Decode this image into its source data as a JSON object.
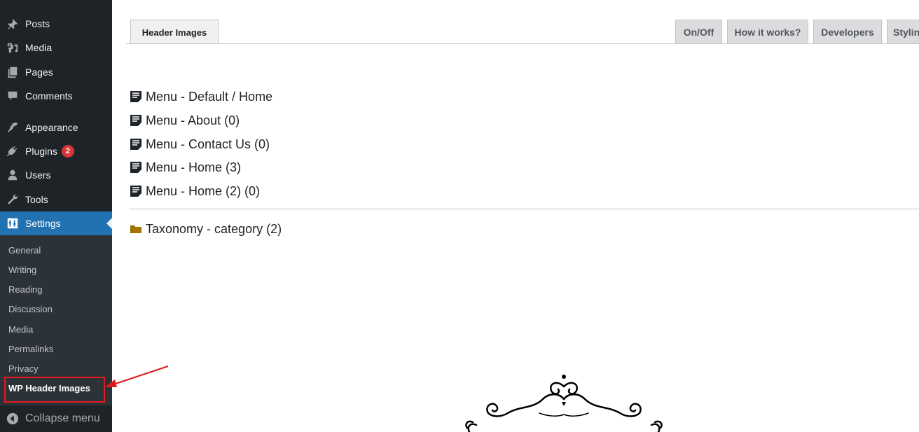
{
  "sidebar": {
    "items": [
      {
        "label": "Posts",
        "icon": "pin-icon"
      },
      {
        "label": "Media",
        "icon": "media-icon"
      },
      {
        "label": "Pages",
        "icon": "pages-icon"
      },
      {
        "label": "Comments",
        "icon": "comment-icon"
      },
      {
        "label": "Appearance",
        "icon": "paintbrush-icon"
      },
      {
        "label": "Plugins",
        "icon": "plugin-icon",
        "badge": "2"
      },
      {
        "label": "Users",
        "icon": "user-icon"
      },
      {
        "label": "Tools",
        "icon": "wrench-icon"
      },
      {
        "label": "Settings",
        "icon": "settings-icon",
        "active": true
      }
    ],
    "submenu": [
      {
        "label": "General"
      },
      {
        "label": "Writing"
      },
      {
        "label": "Reading"
      },
      {
        "label": "Discussion"
      },
      {
        "label": "Media"
      },
      {
        "label": "Permalinks"
      },
      {
        "label": "Privacy"
      },
      {
        "label": "WP Header Images",
        "current": true
      }
    ],
    "collapse_label": "Collapse menu"
  },
  "tabs": {
    "active": "Header Images",
    "right": [
      "On/Off",
      "How it works?",
      "Developers",
      "Styling"
    ]
  },
  "list": {
    "menus": [
      "Menu - Default / Home",
      "Menu - About (0)",
      "Menu - Contact Us (0)",
      "Menu - Home (3)",
      "Menu - Home (2) (0)"
    ],
    "taxonomies": [
      "Taxonomy - category (2)"
    ]
  },
  "colors": {
    "sidebar_bg": "#1d2327",
    "submenu_bg": "#2c3338",
    "accent": "#2271b1",
    "badge": "#d63638",
    "annotation": "#e0191f",
    "folder": "#9a6a00"
  }
}
